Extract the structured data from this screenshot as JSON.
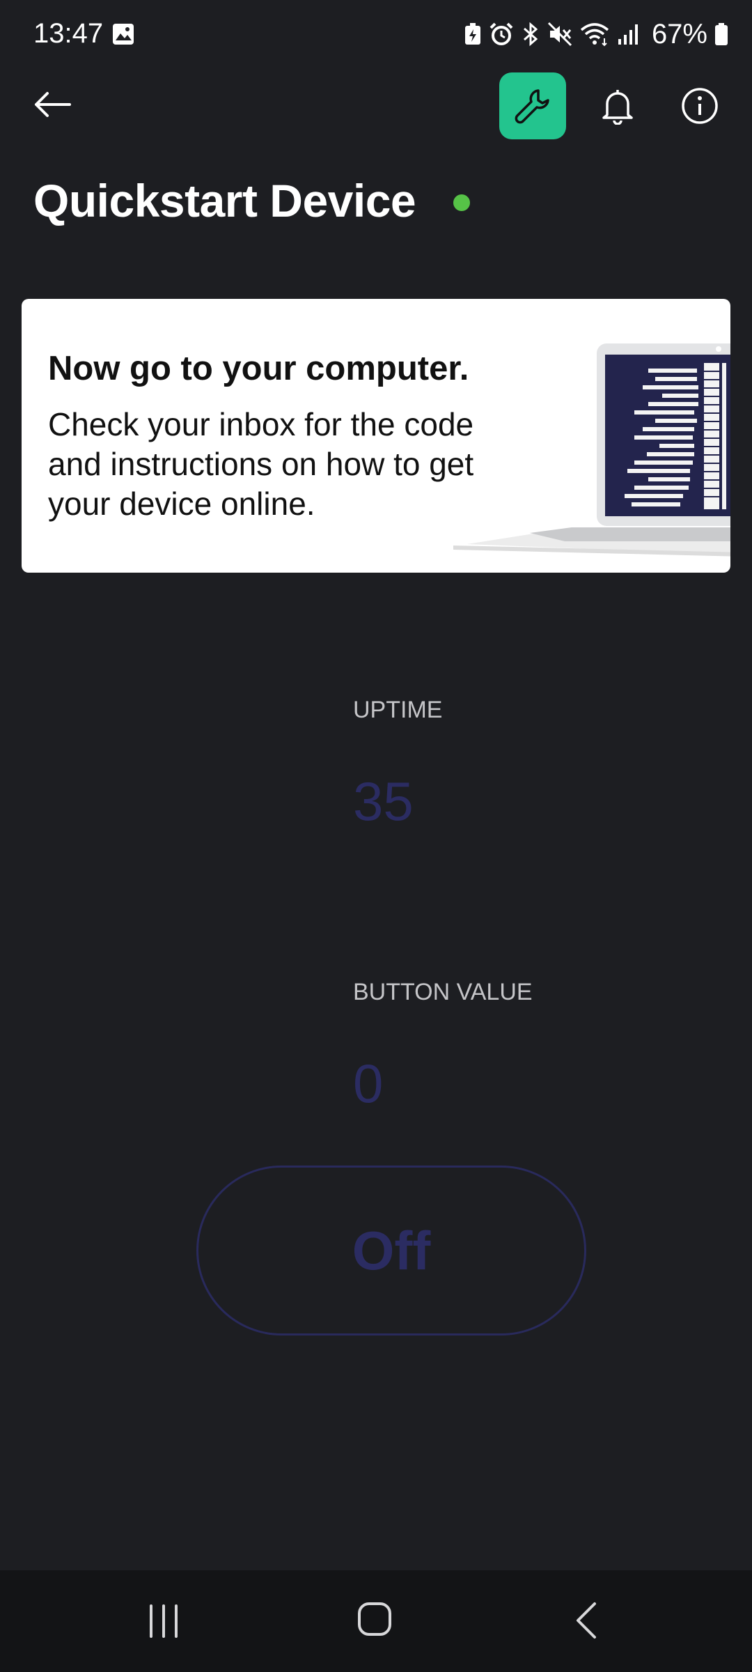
{
  "status_bar": {
    "time": "13:47",
    "battery": "67%",
    "icons": [
      "gallery-icon",
      "battery-saver-icon",
      "alarm-icon",
      "bluetooth-icon",
      "mute-icon",
      "wifi-icon",
      "signal-icon",
      "battery-icon"
    ]
  },
  "app_bar": {
    "icons": [
      "back-arrow-icon",
      "wrench-icon",
      "bell-icon",
      "info-icon"
    ],
    "accent_color": "#23c48e"
  },
  "device": {
    "title": "Quickstart Device",
    "status_color": "#56c247"
  },
  "banner": {
    "heading": "Now go to your computer.",
    "text": "Check your inbox for the code and instructions on how to get your device online."
  },
  "widgets": {
    "uptime": {
      "label": "UPTIME",
      "value": "35"
    },
    "button_value": {
      "label": "BUTTON VALUE",
      "value": "0"
    },
    "switch": {
      "label": "Off"
    }
  },
  "nav_bar": {
    "icons": [
      "recents-icon",
      "home-icon",
      "back-icon"
    ]
  }
}
